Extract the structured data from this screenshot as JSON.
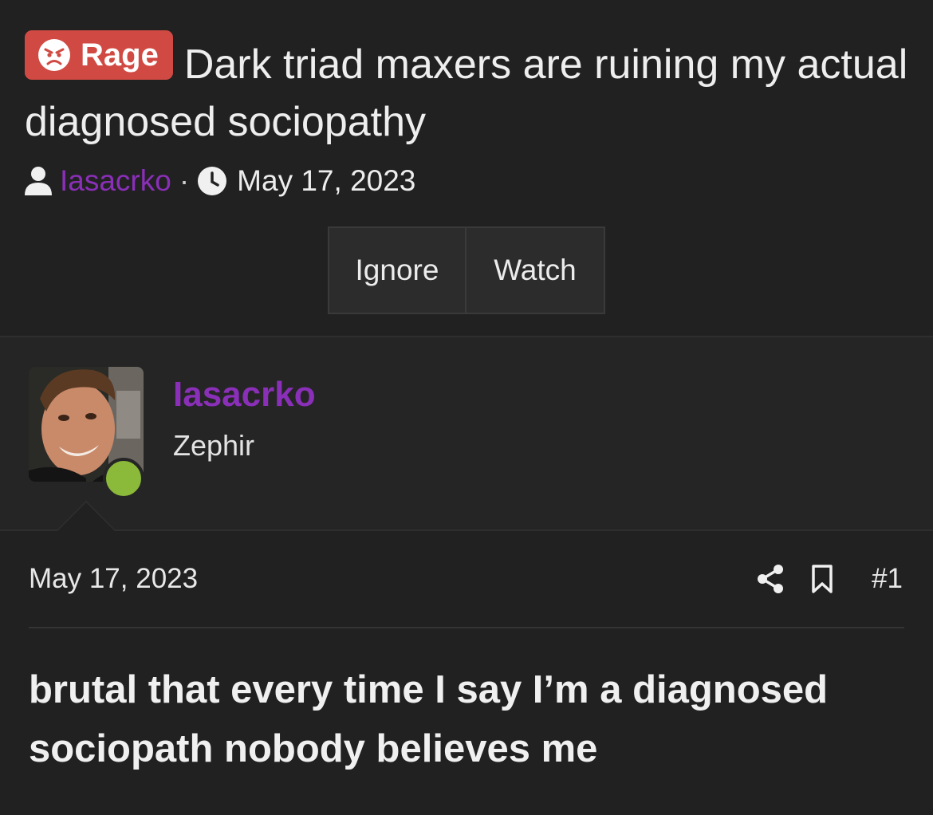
{
  "thread": {
    "prefix": {
      "label": "Rage",
      "icon": "angry-face-icon",
      "color": "#d04a43"
    },
    "title": "Dark triad maxers are ruining my actual diagnosed sociopathy",
    "meta": {
      "author": "Iasacrko",
      "separator": "·",
      "date": "May 17, 2023"
    },
    "buttons": {
      "ignore": "Ignore",
      "watch": "Watch"
    }
  },
  "post": {
    "author": {
      "name": "Iasacrko",
      "title": "Zephir",
      "online": true
    },
    "date": "May 17, 2023",
    "number": "#1",
    "body": "brutal that every time I say I’m a diagnosed sociopath nobody believes me"
  },
  "colors": {
    "background": "#212121",
    "username": "#8a2fb8",
    "online_indicator": "#8bba3a",
    "rage_badge": "#d04a43"
  }
}
